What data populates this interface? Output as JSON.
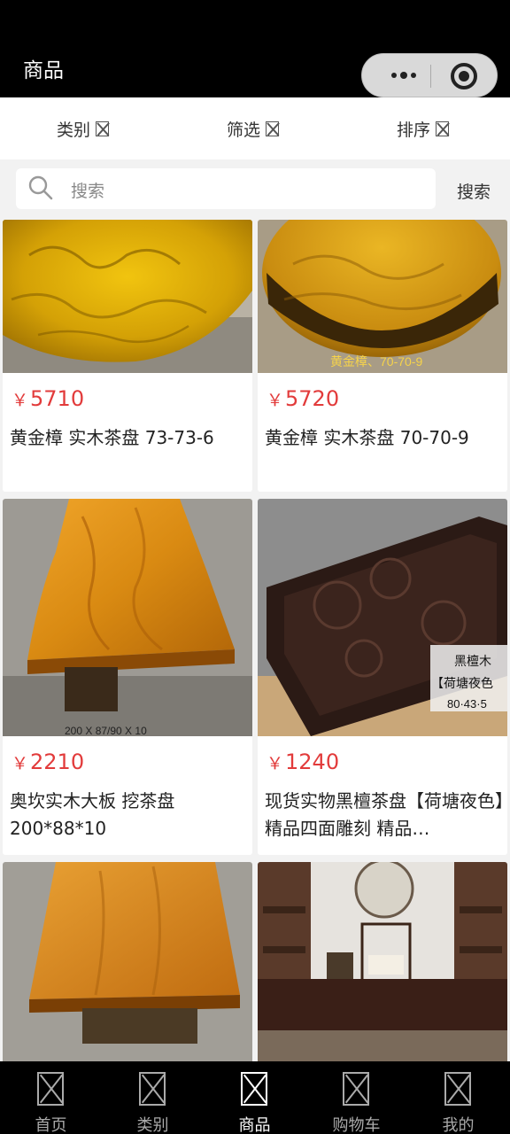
{
  "header": {
    "title": "商品"
  },
  "filters": {
    "category": "类别",
    "filter": "筛选",
    "sort": "排序"
  },
  "search": {
    "placeholder": "搜索",
    "button": "搜索"
  },
  "currency_symbol": "￥",
  "products": [
    {
      "price": "5710",
      "name": "黄金樟 实木茶盘 73-73-6"
    },
    {
      "price": "5720",
      "name": "黄金樟 实木茶盘 70-70-9",
      "image_caption": "黄金樟、70-70-9"
    },
    {
      "price": "2210",
      "name": "奥坎实木大板 挖茶盘 200*88*10",
      "image_caption": "200 X 87/90 X 10"
    },
    {
      "price": "1240",
      "name": "现货实物黑檀茶盘【荷塘夜色】精品四面雕刻 精品…",
      "image_caption_lines": [
        "黑檀木",
        "【荷塘夜色",
        "80·43·5"
      ]
    },
    {
      "price": "",
      "name": ""
    },
    {
      "price": "",
      "name": ""
    }
  ],
  "tabbar": {
    "items": [
      "首页",
      "类别",
      "商品",
      "购物车",
      "我的"
    ],
    "active": "商品"
  },
  "colors": {
    "price": "#e23b3b",
    "header_bg": "#000000",
    "tabbar_bg": "#000000"
  }
}
